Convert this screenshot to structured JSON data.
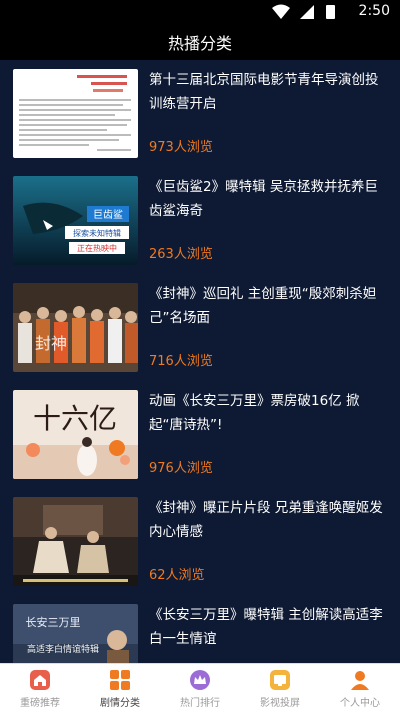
{
  "status_bar": {
    "time": "2:50"
  },
  "header": {
    "title": "热播分类"
  },
  "feed": [
    {
      "title": "第十三届北京国际电影节青年导演创投训练营开启",
      "views": "973人浏览",
      "thumb_icon": "document-icon"
    },
    {
      "title": "《巨齿鲨2》曝特辑 吴京拯救并抚养巨齿鲨海奇",
      "views": "263人浏览",
      "thumb_icon": "shark-movie-icon",
      "thumb_text": [
        "巨齿鲨",
        "探索未知特辑",
        "正在热映中"
      ]
    },
    {
      "title": "《封神》巡回礼 主创重现“殷郊刺杀妲己”名场面",
      "views": "716人浏览",
      "thumb_icon": "crowd-photo-icon",
      "thumb_text": [
        "封神"
      ]
    },
    {
      "title": "动画《长安三万里》票房破16亿 掀起“唐诗热”!",
      "views": "976人浏览",
      "thumb_icon": "poster-icon",
      "thumb_text": [
        "十六亿"
      ]
    },
    {
      "title": "《封神》曝正片片段 兄弟重逢唤醒姬发内心情感",
      "views": "62人浏览",
      "thumb_icon": "movie-still-icon"
    },
    {
      "title": "《长安三万里》曝特辑 主创解读高适李白一生情谊",
      "views": "",
      "thumb_icon": "poster-icon",
      "thumb_text": [
        "长安三万里",
        "高适李白情谊特辑"
      ]
    }
  ],
  "bottom_nav": [
    {
      "label": "重磅推荐",
      "icon": "home-icon",
      "color": "#e8604c"
    },
    {
      "label": "剧情分类",
      "icon": "grid-icon",
      "color": "#f07a21",
      "active": true
    },
    {
      "label": "热门排行",
      "icon": "crown-icon",
      "color": "#9b6bd6"
    },
    {
      "label": "影视投屏",
      "icon": "cast-icon",
      "color": "#f3b33d"
    },
    {
      "label": "个人中心",
      "icon": "user-icon",
      "color": "#f07a21"
    }
  ]
}
